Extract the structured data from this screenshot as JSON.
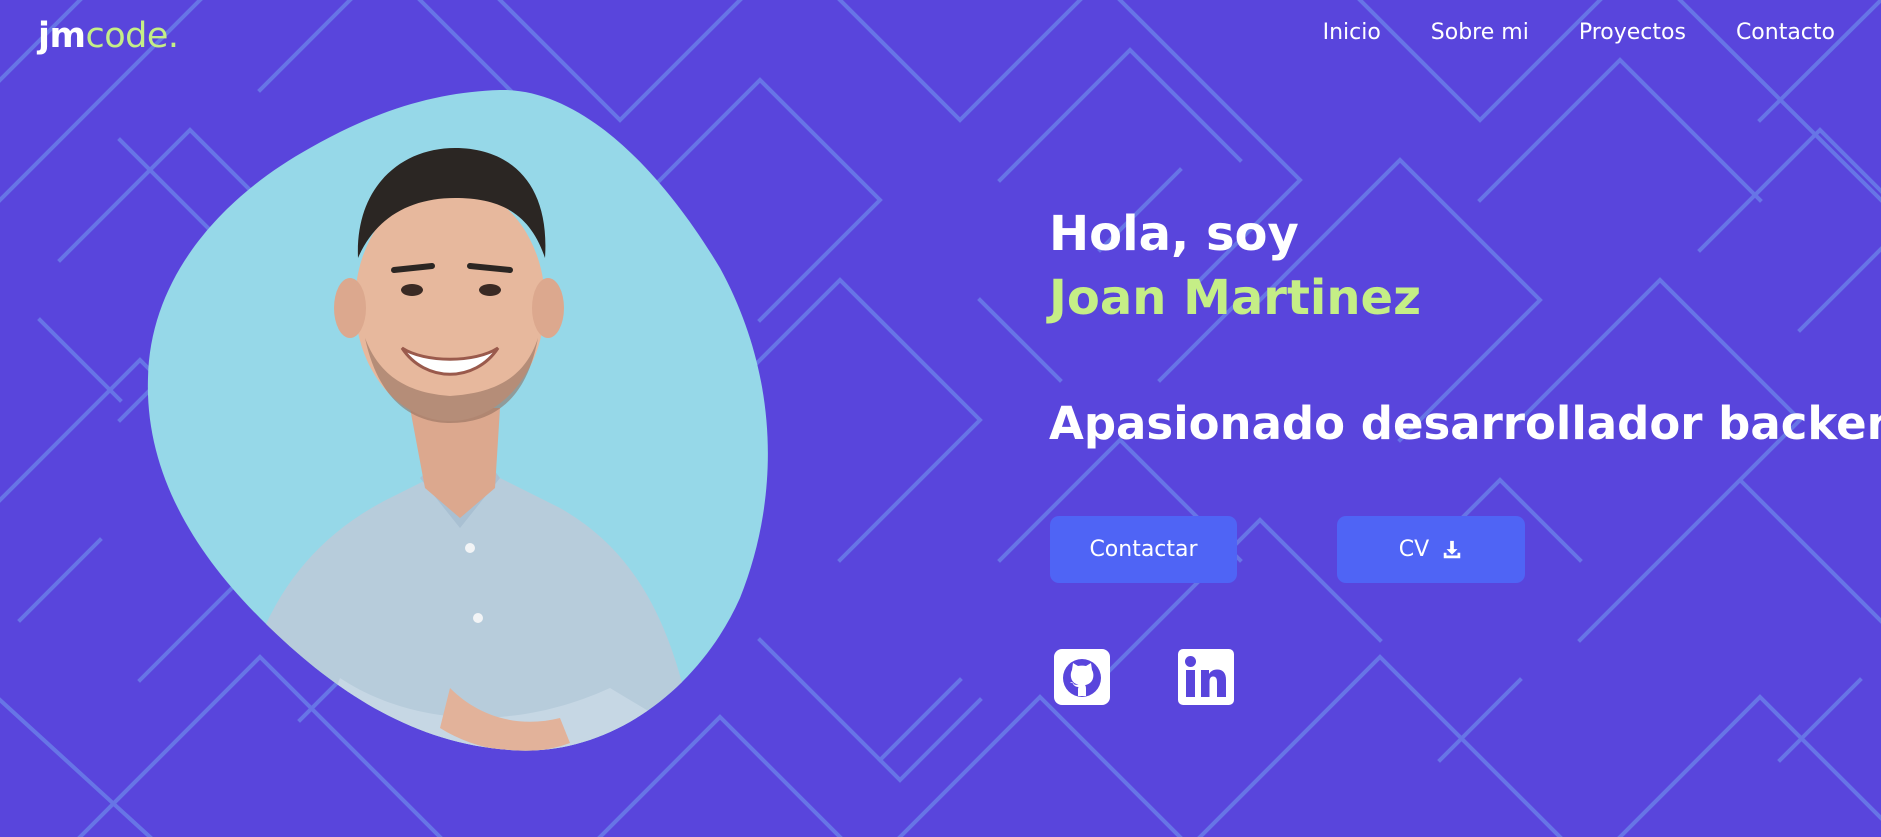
{
  "brand": {
    "logo_part1": "jm",
    "logo_part2": "code."
  },
  "nav": {
    "items": [
      {
        "label": "Inicio"
      },
      {
        "label": "Sobre mi"
      },
      {
        "label": "Proyectos"
      },
      {
        "label": "Contacto"
      }
    ]
  },
  "hero": {
    "greeting": "Hola, soy",
    "name": "Joan Martinez",
    "tagline": "Apasionado desarrollador backend",
    "contact_button": "Contactar",
    "cv_button": "CV"
  },
  "social": {
    "github_icon": "github-icon",
    "linkedin_icon": "linkedin-icon"
  },
  "colors": {
    "background": "#5945dc",
    "pattern_lines": "#6a7ee8",
    "accent_green": "#c5ee86",
    "button_blue": "#4f64f5",
    "portrait_blob": "#96d8e8"
  }
}
